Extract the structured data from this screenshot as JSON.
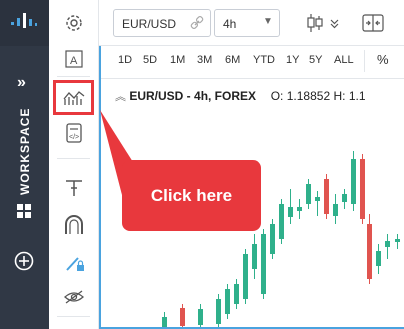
{
  "workspace": {
    "label": "WORKSPACE",
    "expand_icon": "»",
    "grid_icon": "grid-icon",
    "add_icon": "plus-circle-icon"
  },
  "toolbar": {
    "symbol": "EUR/USD",
    "interval": "4h",
    "chart_type_icon": "candlestick-icon",
    "compare_icon": "compare-icon"
  },
  "timeframes": [
    "1D",
    "5D",
    "1M",
    "3M",
    "6M",
    "YTD",
    "1Y",
    "5Y",
    "ALL"
  ],
  "percent_label": "%",
  "legend": {
    "title": "EUR/USD - 4h, FOREX",
    "open_label": "O:",
    "open_value": "1.18852",
    "high_label": "H:",
    "high_value": "1.1"
  },
  "callout": {
    "text": "Click here"
  },
  "highlight_color": "#e8383d",
  "accent_color": "#4aa3df"
}
